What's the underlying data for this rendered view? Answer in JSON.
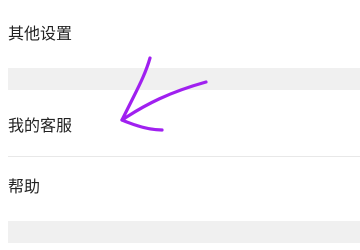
{
  "menu": {
    "items": [
      {
        "label": "其他设置"
      },
      {
        "label": "我的客服"
      },
      {
        "label": "帮助"
      }
    ]
  },
  "annotation": {
    "icon": "hand-drawn-arrow-icon",
    "color": "#a020f0"
  }
}
